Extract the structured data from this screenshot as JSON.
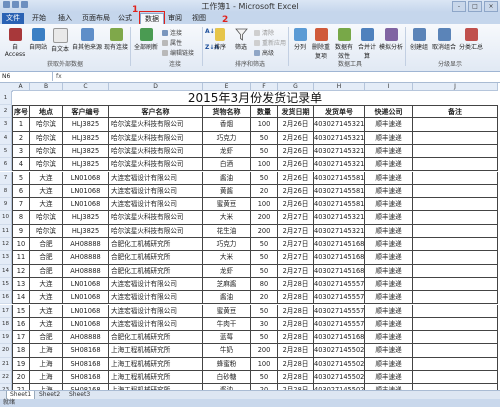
{
  "window": {
    "title": "工作簿1 - Microsoft Excel",
    "controls": [
      "-",
      "□",
      "×"
    ]
  },
  "tabs": [
    {
      "label": "文件",
      "kind": "file"
    },
    {
      "label": "开始",
      "kind": "normal"
    },
    {
      "label": "插入",
      "kind": "normal"
    },
    {
      "label": "页面布局",
      "kind": "normal"
    },
    {
      "label": "公式",
      "kind": "normal"
    },
    {
      "label": "数据",
      "kind": "active"
    },
    {
      "label": "审阅",
      "kind": "normal"
    },
    {
      "label": "视图",
      "kind": "normal"
    }
  ],
  "annotations": {
    "step1": "1",
    "step2": "2"
  },
  "ribbon": {
    "external": {
      "buttons": [
        "自 Access",
        "自网站",
        "自文本",
        "自其他来源",
        "现有连接"
      ],
      "group_label": "获取外部数据"
    },
    "connections": {
      "refresh_all": "全部刷新",
      "small": [
        "连接",
        "属性",
        "编辑链接"
      ],
      "group_label": "连接"
    },
    "sort_filter": {
      "sort_az": "A↓Z",
      "sort_za": "Z↓A",
      "sort": "排序",
      "filter": "筛选",
      "small": [
        "清除",
        "重新应用",
        "高级"
      ],
      "group_label": "排序和筛选"
    },
    "data_tools": {
      "buttons": [
        "分列",
        "删除重复项",
        "数据有效性",
        "合并计算",
        "模拟分析"
      ],
      "group_label": "数据工具"
    },
    "outline": {
      "buttons": [
        "创建组",
        "取消组合",
        "分类汇总"
      ],
      "group_label": "分级显示"
    }
  },
  "formula_bar": {
    "name_box": "N6",
    "fx": "fx"
  },
  "columns": [
    "A",
    "B",
    "C",
    "D",
    "E",
    "F",
    "G",
    "H",
    "I",
    "J"
  ],
  "row_numbers": [
    "1",
    "2",
    "3",
    "4",
    "5",
    "6",
    "7",
    "8",
    "9",
    "10",
    "11",
    "12",
    "13",
    "14",
    "15",
    "16",
    "17",
    "18",
    "19",
    "20",
    "21",
    "22",
    "23"
  ],
  "sheet": {
    "title": "2015年3月份发货记录单",
    "headers": [
      "序号",
      "地点",
      "客户编号",
      "客户名称",
      "货物名称",
      "数量",
      "发货日期",
      "发货单号",
      "快递公司",
      "备注"
    ],
    "rows": [
      [
        "1",
        "哈尔滨",
        "HLJ3825",
        "哈尔滨星火科技有限公司",
        "香烟",
        "100",
        "2月26日",
        "403027145321",
        "顺丰速递",
        ""
      ],
      [
        "2",
        "哈尔滨",
        "HLJ3825",
        "哈尔滨星火科技有限公司",
        "巧克力",
        "50",
        "2月26日",
        "403027145321",
        "顺丰速递",
        ""
      ],
      [
        "3",
        "哈尔滨",
        "HLJ3825",
        "哈尔滨星火科技有限公司",
        "龙虾",
        "50",
        "2月26日",
        "403027145321",
        "顺丰速递",
        ""
      ],
      [
        "4",
        "哈尔滨",
        "HLJ3825",
        "哈尔滨星火科技有限公司",
        "白酒",
        "100",
        "2月26日",
        "403027145321",
        "顺丰速递",
        ""
      ],
      [
        "5",
        "大连",
        "LN01068",
        "大连宏福设计有限公司",
        "酱油",
        "50",
        "2月26日",
        "403027145581",
        "顺丰速递",
        ""
      ],
      [
        "6",
        "大连",
        "LN01068",
        "大连宏福设计有限公司",
        "黄酱",
        "20",
        "2月26日",
        "403027145581",
        "顺丰速递",
        ""
      ],
      [
        "7",
        "大连",
        "LN01068",
        "大连宏福设计有限公司",
        "蜜黄豆",
        "100",
        "2月26日",
        "403027145581",
        "顺丰速递",
        ""
      ],
      [
        "8",
        "哈尔滨",
        "HLJ3825",
        "哈尔滨星火科技有限公司",
        "大米",
        "200",
        "2月27日",
        "403027145321",
        "顺丰速递",
        ""
      ],
      [
        "9",
        "哈尔滨",
        "HLJ3825",
        "哈尔滨星火科技有限公司",
        "花生油",
        "200",
        "2月27日",
        "403027145321",
        "顺丰速递",
        ""
      ],
      [
        "10",
        "合肥",
        "AH08888",
        "合肥化工机械研究所",
        "巧克力",
        "50",
        "2月27日",
        "403027145168",
        "顺丰速递",
        ""
      ],
      [
        "11",
        "合肥",
        "AH08888",
        "合肥化工机械研究所",
        "大米",
        "50",
        "2月27日",
        "403027145168",
        "顺丰速递",
        ""
      ],
      [
        "12",
        "合肥",
        "AH08888",
        "合肥化工机械研究所",
        "龙虾",
        "50",
        "2月27日",
        "403027145168",
        "顺丰速递",
        ""
      ],
      [
        "13",
        "大连",
        "LN01068",
        "大连宏福设计有限公司",
        "芝麻酱",
        "80",
        "2月28日",
        "403027145557",
        "顺丰速递",
        ""
      ],
      [
        "14",
        "大连",
        "LN01068",
        "大连宏福设计有限公司",
        "酱油",
        "20",
        "2月28日",
        "403027145557",
        "顺丰速递",
        ""
      ],
      [
        "15",
        "大连",
        "LN01068",
        "大连宏福设计有限公司",
        "蜜黄豆",
        "50",
        "2月28日",
        "403027145557",
        "顺丰速递",
        ""
      ],
      [
        "16",
        "大连",
        "LN01068",
        "大连宏福设计有限公司",
        "牛肉干",
        "30",
        "2月28日",
        "403027145557",
        "顺丰速递",
        ""
      ],
      [
        "17",
        "合肥",
        "AH08888",
        "合肥化工机械研究所",
        "蓝莓",
        "50",
        "2月28日",
        "403027145168",
        "顺丰速递",
        ""
      ],
      [
        "18",
        "上海",
        "SH08168",
        "上海工程机械研究所",
        "牛奶",
        "200",
        "2月28日",
        "403027145502",
        "顺丰速递",
        ""
      ],
      [
        "19",
        "上海",
        "SH08168",
        "上海工程机械研究所",
        "蜂蜜粉",
        "100",
        "2月28日",
        "403027145502",
        "顺丰速递",
        ""
      ],
      [
        "20",
        "上海",
        "SH08168",
        "上海工程机械研究所",
        "白砂糖",
        "50",
        "2月28日",
        "403027145502",
        "顺丰速递",
        ""
      ],
      [
        "21",
        "上海",
        "SH08168",
        "上海工程机械研究所",
        "酱油",
        "20",
        "2月28日",
        "403027145502",
        "顺丰速递",
        ""
      ]
    ]
  },
  "sheet_tabs": [
    "Sheet1",
    "Sheet2",
    "Sheet3"
  ],
  "status": "就绪"
}
